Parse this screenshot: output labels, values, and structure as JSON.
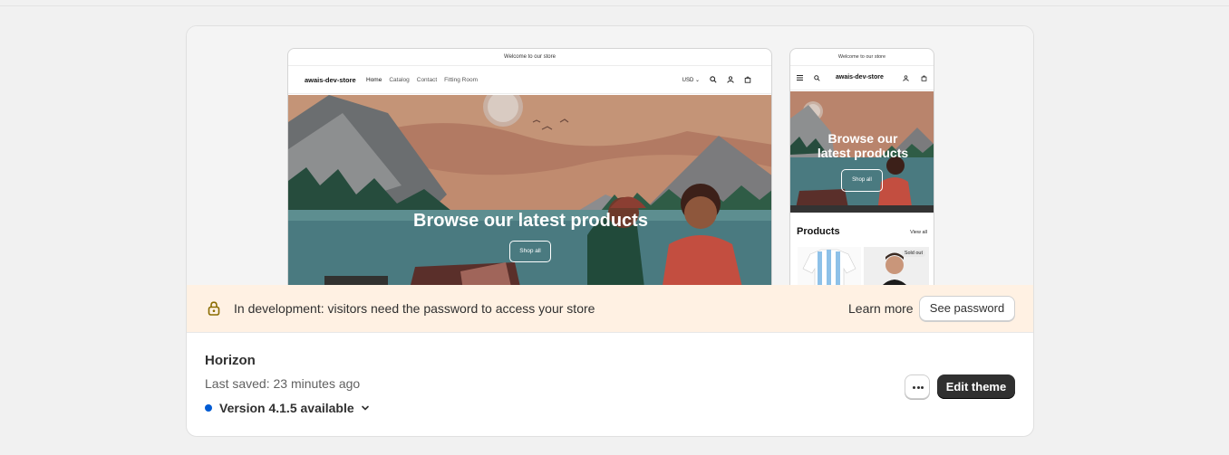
{
  "preview": {
    "announcement": "Welcome to our store",
    "store_name": "awais-dev-store",
    "nav_links": [
      "Home",
      "Catalog",
      "Contact",
      "Fitting Room"
    ],
    "currency": "USD",
    "hero_title": "Browse our latest products",
    "hero_title_mobile_line1": "Browse our",
    "hero_title_mobile_line2": "latest products",
    "shop_all": "Shop all",
    "products_heading": "Products",
    "view_all": "View all",
    "sold_out": "Sold out"
  },
  "banner": {
    "text": "In development: visitors need the password to access your store",
    "learn_more": "Learn more",
    "see_password": "See password",
    "icon": "lock-icon"
  },
  "theme": {
    "name": "Horizon",
    "last_saved": "Last saved: 23 minutes ago",
    "version": "Version 4.1.5 available",
    "edit_label": "Edit theme",
    "accent": "#005bd3"
  }
}
